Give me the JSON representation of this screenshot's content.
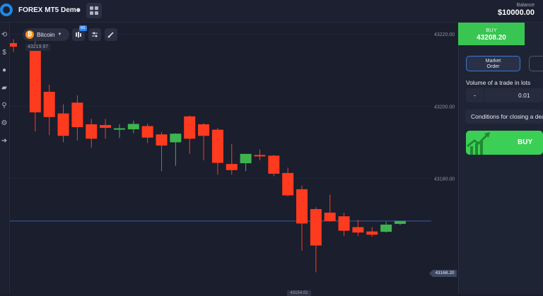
{
  "header": {
    "account_name": "FOREX MT5 Demo",
    "balance_label": "Balance",
    "balance_value": "$10000.00"
  },
  "toolbar": {
    "asset": "Bitcoin",
    "timeframe_badge": "M1",
    "high_price_tag": "43219.97"
  },
  "chart": {
    "current_price_tag": "43168.20",
    "low_price_tag": "43154.02",
    "y_ticks": [
      "43220.00",
      "43200.00",
      "43180.00"
    ]
  },
  "chart_data": {
    "type": "candlestick",
    "ylim": [
      43148,
      43222
    ],
    "y_ticks": [
      43220,
      43200,
      43180
    ],
    "current_price": 43168.2,
    "candles": [
      {
        "o": 43217.5,
        "h": 43218.6,
        "l": 43215.0,
        "c": 43216.5
      },
      {
        "o": 43216.5,
        "h": 43218.0,
        "l": 43193.0,
        "c": 43198.3
      },
      {
        "o": 43204.0,
        "h": 43206.0,
        "l": 43192.0,
        "c": 43197.0
      },
      {
        "o": 43198.0,
        "h": 43200.5,
        "l": 43190.0,
        "c": 43191.8
      },
      {
        "o": 43201.0,
        "h": 43203.0,
        "l": 43190.5,
        "c": 43194.2
      },
      {
        "o": 43195.0,
        "h": 43196.5,
        "l": 43188.5,
        "c": 43191.0
      },
      {
        "o": 43194.8,
        "h": 43196.5,
        "l": 43191.0,
        "c": 43194.0
      },
      {
        "o": 43193.5,
        "h": 43195.0,
        "l": 43191.2,
        "c": 43193.9
      },
      {
        "o": 43193.6,
        "h": 43196.0,
        "l": 43192.5,
        "c": 43195.1
      },
      {
        "o": 43194.5,
        "h": 43195.2,
        "l": 43189.8,
        "c": 43191.3
      },
      {
        "o": 43192.2,
        "h": 43192.8,
        "l": 43182.0,
        "c": 43189.1
      },
      {
        "o": 43190.0,
        "h": 43192.5,
        "l": 43183.5,
        "c": 43192.4
      },
      {
        "o": 43197.2,
        "h": 43197.4,
        "l": 43186.8,
        "c": 43191.0
      },
      {
        "o": 43195.0,
        "h": 43195.3,
        "l": 43185.0,
        "c": 43191.8
      },
      {
        "o": 43193.5,
        "h": 43194.0,
        "l": 43181.0,
        "c": 43184.3
      },
      {
        "o": 43184.0,
        "h": 43189.5,
        "l": 43181.0,
        "c": 43182.3
      },
      {
        "o": 43184.2,
        "h": 43184.6,
        "l": 43182.0,
        "c": 43186.8
      },
      {
        "o": 43186.5,
        "h": 43188.0,
        "l": 43185.0,
        "c": 43186.1
      },
      {
        "o": 43186.3,
        "h": 43186.5,
        "l": 43180.6,
        "c": 43181.3
      },
      {
        "o": 43181.5,
        "h": 43183.0,
        "l": 43175.0,
        "c": 43175.3
      },
      {
        "o": 43177.0,
        "h": 43178.0,
        "l": 43160.0,
        "c": 43167.5
      },
      {
        "o": 43171.5,
        "h": 43172.0,
        "l": 43154.0,
        "c": 43161.4
      },
      {
        "o": 43170.5,
        "h": 43175.5,
        "l": 43168.0,
        "c": 43168.2
      },
      {
        "o": 43169.5,
        "h": 43170.5,
        "l": 43164.0,
        "c": 43165.5
      },
      {
        "o": 43166.5,
        "h": 43168.5,
        "l": 43164.0,
        "c": 43165.0
      },
      {
        "o": 43165.3,
        "h": 43166.5,
        "l": 43163.8,
        "c": 43164.4
      },
      {
        "o": 43165.2,
        "h": 43168.0,
        "l": 43165.0,
        "c": 43167.2
      },
      {
        "o": 43167.4,
        "h": 43168.0,
        "l": 43167.1,
        "c": 43168.2
      }
    ]
  },
  "panel": {
    "buy_header_label": "BUY",
    "buy_header_price": "43208.20",
    "tab_market_line1": "Market",
    "tab_market_line2": "Order",
    "volume_label": "Volume of a trade in lots",
    "volume_minus": "-",
    "volume_value": "0.01",
    "conditions_label": "Conditions for closing a deal",
    "buy_button_label": "BUY"
  },
  "colors": {
    "bull": "#3fb34f",
    "bear": "#ff3b1f",
    "accent_green": "#39c552",
    "accent_blue": "#3b79d9"
  }
}
